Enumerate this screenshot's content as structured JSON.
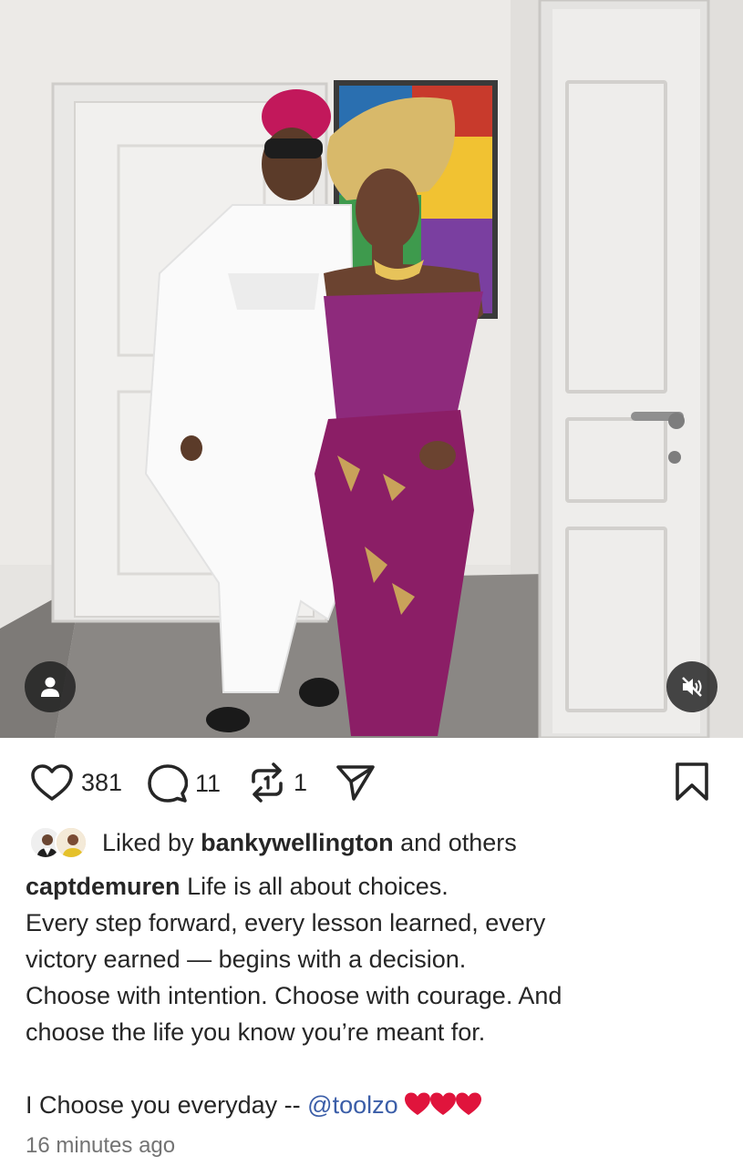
{
  "post": {
    "image_alt": "",
    "tag_icon": "person-icon",
    "mute_icon": "speaker-muted-icon"
  },
  "actions": {
    "like_icon": "heart-icon",
    "like_count": "381",
    "comment_icon": "comment-bubble-icon",
    "comment_count": "11",
    "repost_icon": "repost-icon",
    "repost_count": "1",
    "share_icon": "send-icon",
    "save_icon": "bookmark-icon"
  },
  "likes": {
    "prefix": "Liked by",
    "user": "bankywellington",
    "suffix": "and others"
  },
  "caption": {
    "username": "captdemuren",
    "lines": [
      "Life is all about choices.",
      "Every step forward, every lesson learned, every",
      "victory earned — begins with a decision.",
      "Choose with intention. Choose with courage. And",
      "choose the life you know you’re meant for."
    ],
    "closing_text": "I Choose you everyday --",
    "mention": "@toolzo",
    "emoji": "❤️❤️❤️"
  },
  "timestamp": "16 minutes ago",
  "colors": {
    "text": "#262626",
    "secondary": "#737373",
    "mention": "#3b5ea8",
    "heart_red": "#e0245e"
  }
}
